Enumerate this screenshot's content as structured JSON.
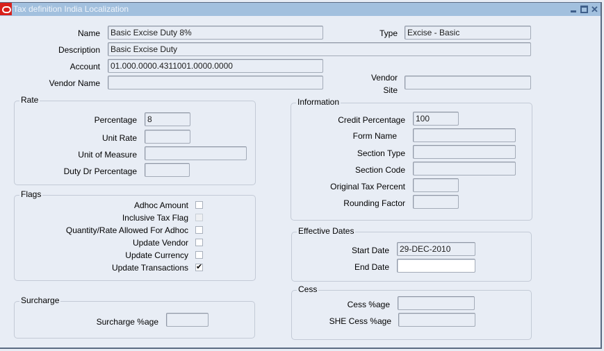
{
  "window": {
    "title": "Tax definition India Localization",
    "controls": {
      "minimize": "minimize",
      "maximize": "maximize",
      "close": "✕"
    }
  },
  "header": {
    "name_label": "Name",
    "name_value": "Basic Excise Duty 8%",
    "type_label": "Type",
    "type_value": "Excise - Basic",
    "description_label": "Description",
    "description_value": "Basic Excise Duty",
    "account_label": "Account",
    "account_value": "01.000.0000.4311001.0000.0000",
    "vendor_name_label": "Vendor Name",
    "vendor_name_value": "",
    "vendor_site_label_1": "Vendor",
    "vendor_site_label_2": "Site",
    "vendor_site_value": ""
  },
  "rate": {
    "title": "Rate",
    "percentage_label": "Percentage",
    "percentage_value": "8",
    "unit_rate_label": "Unit Rate",
    "unit_rate_value": "",
    "uom_label": "Unit of Measure",
    "uom_value": "",
    "duty_dr_label": "Duty Dr Percentage",
    "duty_dr_value": ""
  },
  "flags": {
    "title": "Flags",
    "items": [
      {
        "label": "Adhoc  Amount",
        "checked": false,
        "disabled": false
      },
      {
        "label": "Inclusive Tax Flag",
        "checked": false,
        "disabled": true
      },
      {
        "label": "Quantity/Rate Allowed For Adhoc",
        "checked": false,
        "disabled": false
      },
      {
        "label": "Update Vendor",
        "checked": false,
        "disabled": false
      },
      {
        "label": "Update Currency",
        "checked": false,
        "disabled": false
      },
      {
        "label": "Update Transactions",
        "checked": true,
        "disabled": false
      }
    ],
    "check_glyph": "✔"
  },
  "surcharge": {
    "title": "Surcharge",
    "pct_label": "Surcharge %age",
    "pct_value": ""
  },
  "information": {
    "title": "Information",
    "credit_pct_label": "Credit Percentage",
    "credit_pct_value": "100",
    "form_name_label": "Form Name",
    "form_name_value": "",
    "section_type_label": "Section Type",
    "section_type_value": "",
    "section_code_label": "Section Code",
    "section_code_value": "",
    "orig_tax_label": "Original Tax Percent",
    "orig_tax_value": "",
    "rounding_label": "Rounding Factor",
    "rounding_value": ""
  },
  "effective_dates": {
    "title": "Effective Dates",
    "start_label": "Start Date",
    "start_value": "29-DEC-2010",
    "end_label": "End Date",
    "end_value": ""
  },
  "cess": {
    "title": "Cess",
    "cess_label": "Cess %age",
    "cess_value": "",
    "she_label": "SHE Cess %age",
    "she_value": ""
  }
}
